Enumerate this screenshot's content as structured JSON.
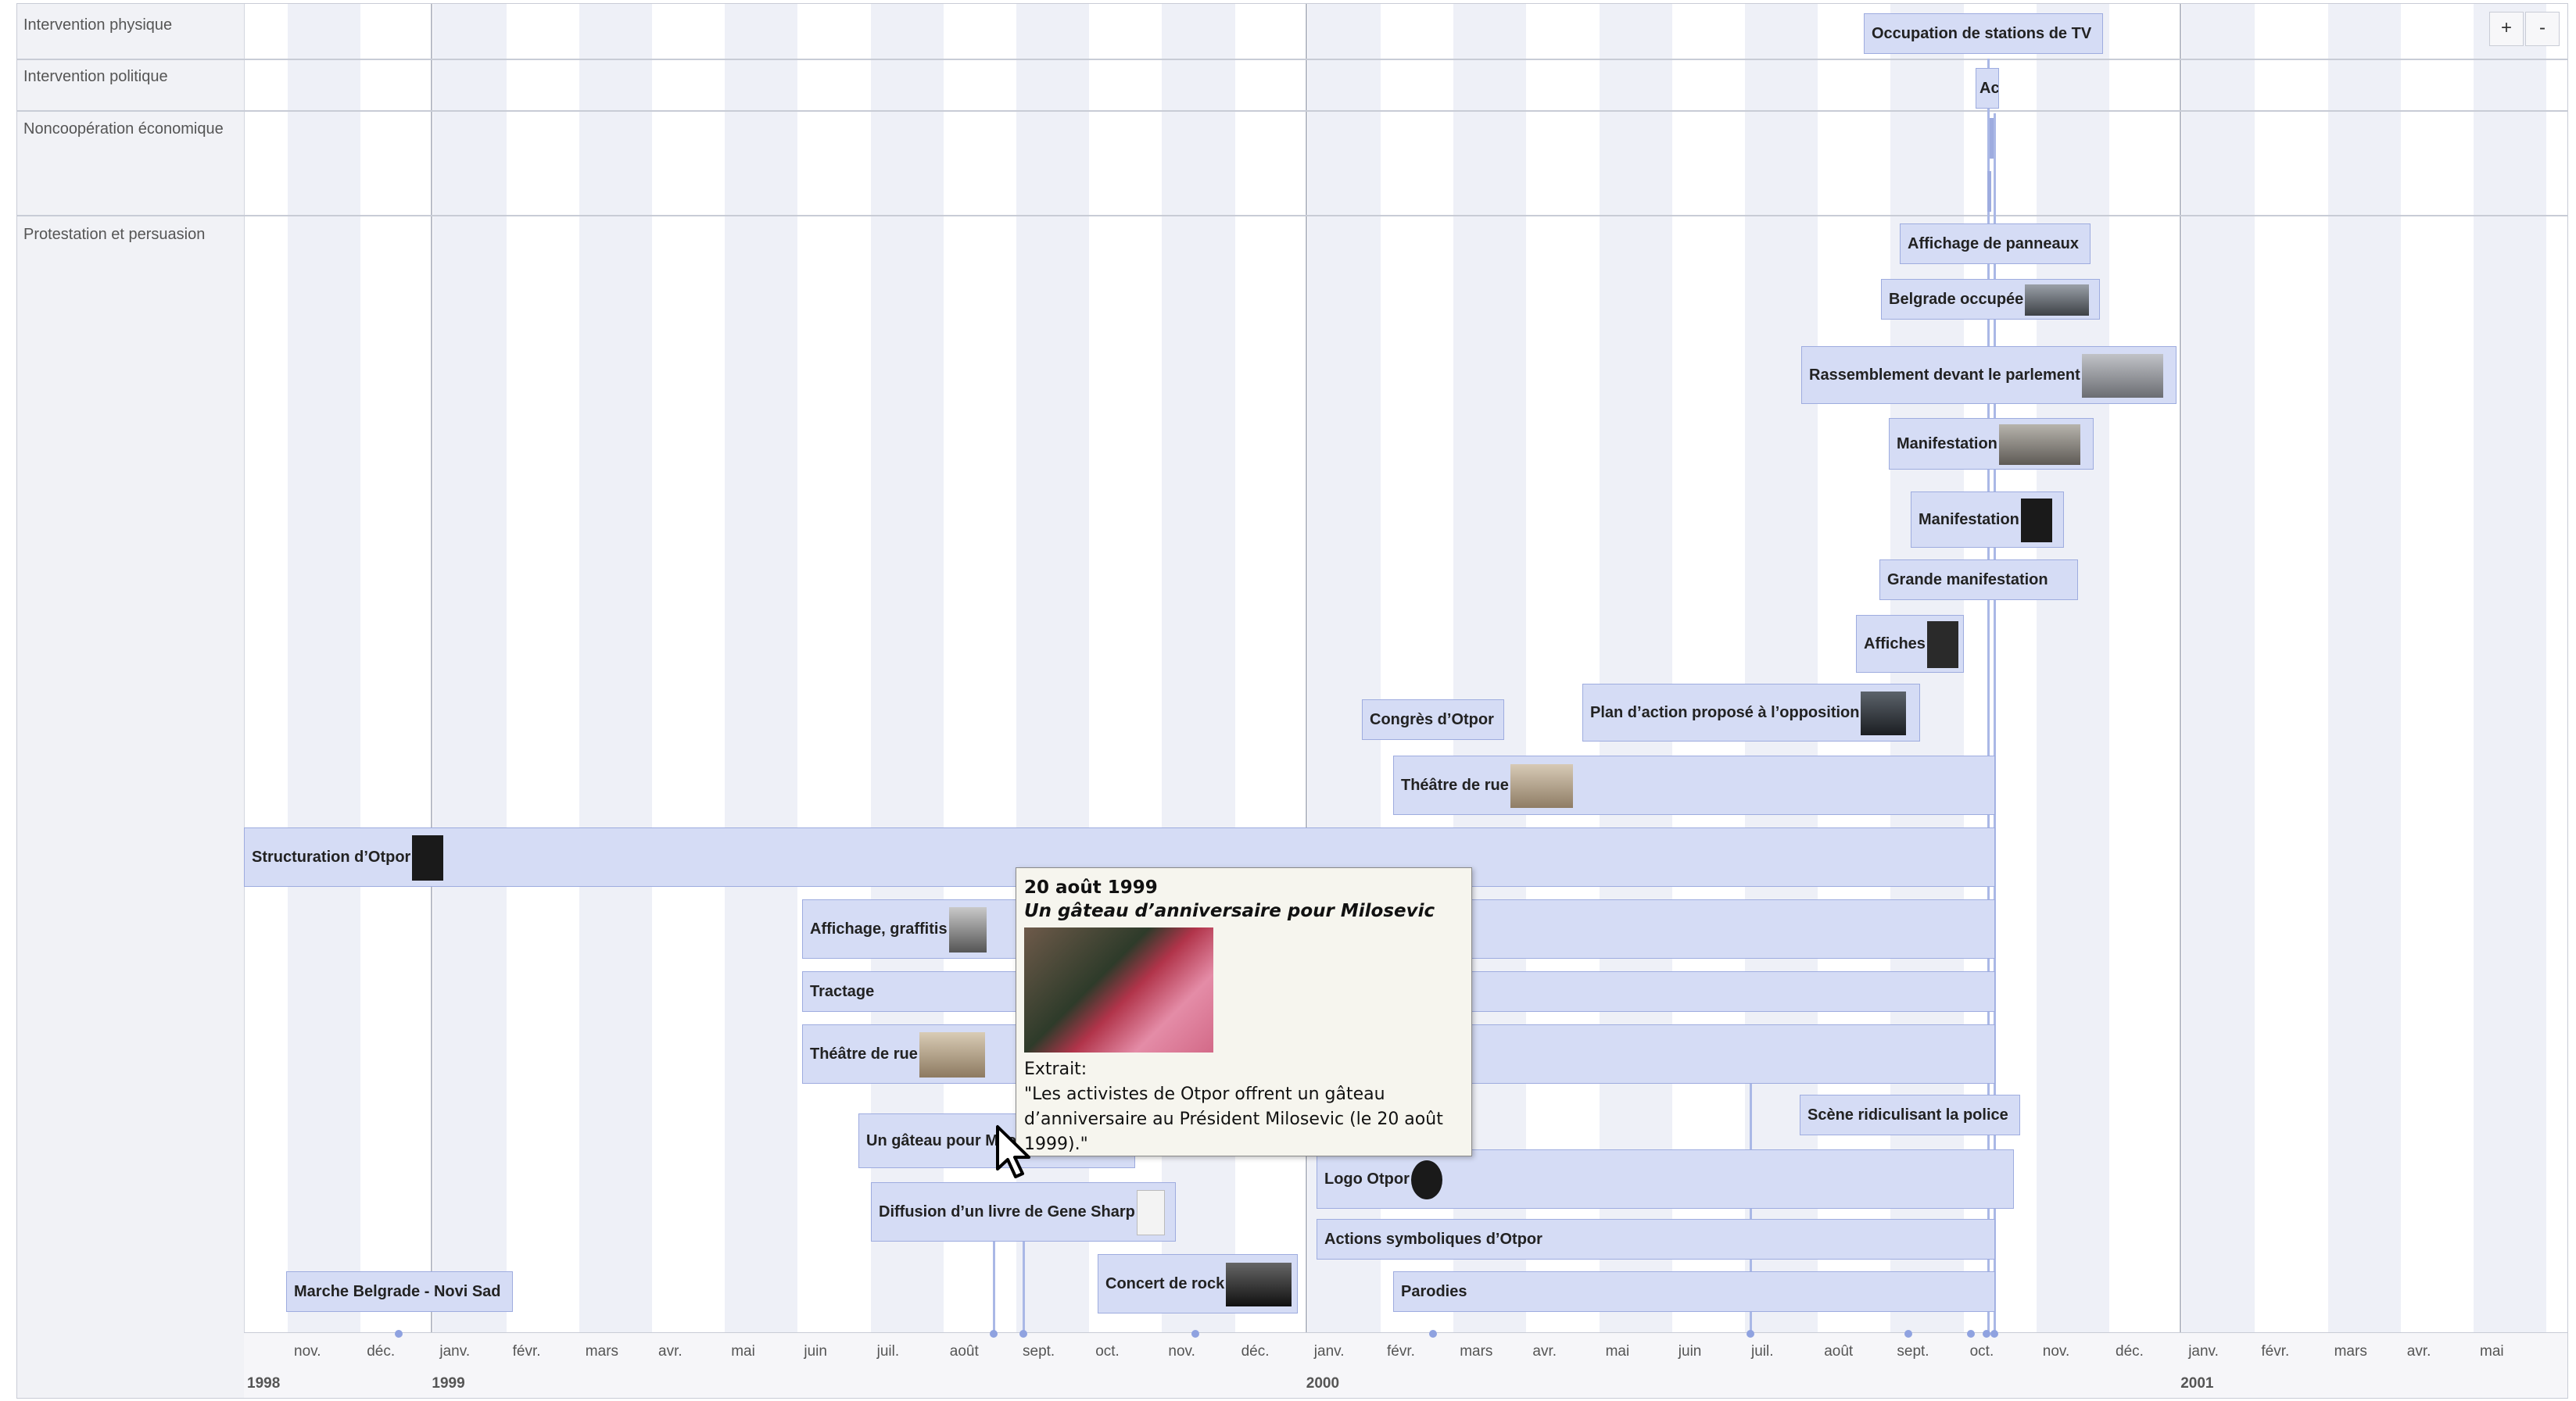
{
  "bands": [
    {
      "id": "physique",
      "label": "Intervention physique"
    },
    {
      "id": "politique",
      "label": "Intervention politique"
    },
    {
      "id": "economique",
      "label": "Noncoopération économique"
    },
    {
      "id": "protestation",
      "label": "Protestation et persuasion"
    }
  ],
  "zoom": {
    "plus": "+",
    "minus": "-"
  },
  "axis": {
    "months": [
      "nov.",
      "déc.",
      "janv.",
      "févr.",
      "mars",
      "avr.",
      "mai",
      "juin",
      "juil.",
      "août",
      "sept.",
      "oct.",
      "nov.",
      "déc.",
      "janv.",
      "févr.",
      "mars",
      "avr.",
      "mai",
      "juin",
      "juil.",
      "août",
      "sept.",
      "oct.",
      "nov.",
      "déc.",
      "janv.",
      "févr.",
      "mars",
      "avr.",
      "mai"
    ],
    "years": [
      "1998",
      "1999",
      "2000",
      "2001"
    ]
  },
  "events": {
    "occupation_tv": "Occupation de stations de TV",
    "ac": "Ac",
    "affichage_panneaux": "Affichage de panneaux",
    "belgrade_occupee": "Belgrade occupée",
    "rassemblement": "Rassemblement devant le parlement",
    "manifestation_1": "Manifestation",
    "manifestation_2": "Manifestation",
    "grande_manifestation": "Grande manifestation",
    "affiches": "Affiches",
    "congres": "Congrès d’Otpor",
    "plan_action": "Plan d’action proposé à l’opposition",
    "theatre_rue_2000": "Théâtre de rue",
    "structuration": "Structuration d’Otpor",
    "affichage_graffitis": "Affichage, graffitis",
    "tractage": "Tractage",
    "theatre_rue_1999": "Théâtre de rue",
    "scene_police": "Scène ridiculisant la police",
    "gateau": "Un gâteau pour Milosevic",
    "logo": "Logo Otpor",
    "diffusion_livre": "Diffusion d’un livre de Gene Sharp",
    "actions_symboliques": "Actions symboliques d’Otpor",
    "marche": "Marche Belgrade - Novi Sad",
    "concert": "Concert de rock",
    "parodies": "Parodies"
  },
  "popup": {
    "date": "20 août 1999",
    "title": "Un gâteau d’anniversaire pour Milosevic",
    "extract_label": "Extrait:",
    "extract_text": "\"Les activistes de Otpor offrent un gâteau d’anniversaire au Président Milosevic (le 20 août 1999).\""
  },
  "colors": {
    "event_fill": "#d5dcf5",
    "event_border": "#9eacdf",
    "shade": "#eef0f7"
  },
  "icons": [
    "otpor-fist-icon",
    "photo-thumbnail-icon",
    "mouse-pointer-icon"
  ]
}
